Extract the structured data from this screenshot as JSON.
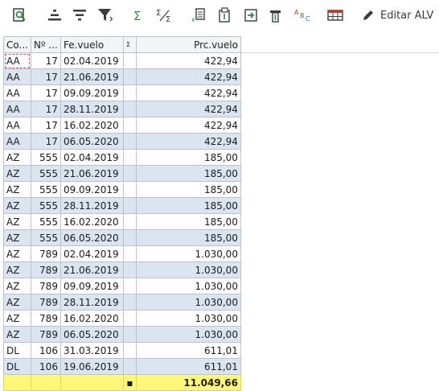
{
  "toolbar": {
    "buttons": [
      {
        "name": "details-icon"
      },
      {
        "name": "sort-ascending-icon"
      },
      {
        "name": "sort-descending-icon"
      },
      {
        "name": "filter-icon"
      },
      {
        "name": "sum-icon"
      },
      {
        "name": "subtotal-icon"
      },
      {
        "name": "export-excel-icon"
      },
      {
        "name": "print-preview-icon"
      },
      {
        "name": "export-icon"
      },
      {
        "name": "layout-icon"
      },
      {
        "name": "abc-analysis-icon"
      },
      {
        "name": "display-table-icon"
      }
    ],
    "edit_alv_label": "Editar ALV"
  },
  "table": {
    "headers": [
      "Co...",
      "Nº ...",
      "Fe.vuelo",
      "Σ",
      "Prc.vuelo"
    ],
    "rows": [
      [
        "AA",
        "17",
        "02.04.2019",
        "",
        "422,94"
      ],
      [
        "AA",
        "17",
        "21.06.2019",
        "",
        "422,94"
      ],
      [
        "AA",
        "17",
        "09.09.2019",
        "",
        "422,94"
      ],
      [
        "AA",
        "17",
        "28.11.2019",
        "",
        "422,94"
      ],
      [
        "AA",
        "17",
        "16.02.2020",
        "",
        "422,94"
      ],
      [
        "AA",
        "17",
        "06.05.2020",
        "",
        "422,94"
      ],
      [
        "AZ",
        "555",
        "02.04.2019",
        "",
        "185,00"
      ],
      [
        "AZ",
        "555",
        "21.06.2019",
        "",
        "185,00"
      ],
      [
        "AZ",
        "555",
        "09.09.2019",
        "",
        "185,00"
      ],
      [
        "AZ",
        "555",
        "28.11.2019",
        "",
        "185,00"
      ],
      [
        "AZ",
        "555",
        "16.02.2020",
        "",
        "185,00"
      ],
      [
        "AZ",
        "555",
        "06.05.2020",
        "",
        "185,00"
      ],
      [
        "AZ",
        "789",
        "02.04.2019",
        "",
        "1.030,00"
      ],
      [
        "AZ",
        "789",
        "21.06.2019",
        "",
        "1.030,00"
      ],
      [
        "AZ",
        "789",
        "09.09.2019",
        "",
        "1.030,00"
      ],
      [
        "AZ",
        "789",
        "28.11.2019",
        "",
        "1.030,00"
      ],
      [
        "AZ",
        "789",
        "16.02.2020",
        "",
        "1.030,00"
      ],
      [
        "AZ",
        "789",
        "06.05.2020",
        "",
        "1.030,00"
      ],
      [
        "DL",
        "106",
        "31.03.2019",
        "",
        "611,01"
      ],
      [
        "DL",
        "106",
        "19.06.2019",
        "",
        "611,01"
      ]
    ],
    "total_marker": "▪",
    "total_value": "11.049,66"
  },
  "colors": {
    "row_alt": "#dbe4f1",
    "total_bg": "#fff77a",
    "accent_green": "#2e8b3a"
  }
}
